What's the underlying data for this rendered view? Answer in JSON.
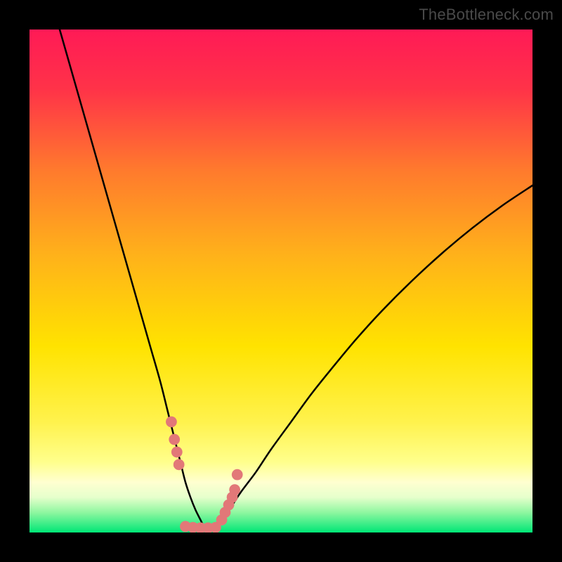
{
  "watermark": "TheBottleneck.com",
  "chart_data": {
    "type": "line",
    "title": "",
    "xlabel": "",
    "ylabel": "",
    "xlim": [
      0,
      100
    ],
    "ylim": [
      0,
      100
    ],
    "background_gradient": {
      "stops": [
        {
          "pct": 0,
          "color": "#ff1a56"
        },
        {
          "pct": 12,
          "color": "#ff3348"
        },
        {
          "pct": 28,
          "color": "#ff7a2d"
        },
        {
          "pct": 45,
          "color": "#ffb21a"
        },
        {
          "pct": 63,
          "color": "#ffe300"
        },
        {
          "pct": 78,
          "color": "#fff24d"
        },
        {
          "pct": 86,
          "color": "#ffff8c"
        },
        {
          "pct": 90,
          "color": "#ffffd0"
        },
        {
          "pct": 93,
          "color": "#e6ffcc"
        },
        {
          "pct": 96,
          "color": "#8ff7a0"
        },
        {
          "pct": 100,
          "color": "#00e676"
        }
      ]
    },
    "series": [
      {
        "name": "left-curve",
        "x": [
          6,
          8,
          10,
          12,
          14,
          16,
          18,
          20,
          22,
          24,
          26,
          27.5,
          29,
          30,
          31,
          32,
          33,
          34,
          34.5,
          35
        ],
        "y": [
          100,
          93,
          86,
          79,
          72,
          65,
          58,
          51,
          44,
          37,
          30,
          24,
          18,
          14,
          10,
          7,
          4.5,
          2.5,
          1.5,
          1
        ]
      },
      {
        "name": "right-curve",
        "x": [
          35,
          36,
          38,
          40,
          42,
          45,
          48,
          52,
          56,
          60,
          65,
          70,
          76,
          82,
          88,
          94,
          100
        ],
        "y": [
          1,
          1.2,
          2.5,
          5,
          8,
          12,
          16.5,
          22,
          27.5,
          32.5,
          38.5,
          44,
          50,
          55.5,
          60.5,
          65,
          69
        ]
      }
    ],
    "markers": {
      "name": "bottleneck-points",
      "color": "#e27878",
      "radius_plot_units": 1.1,
      "points": [
        {
          "x": 28.2,
          "y": 22.0
        },
        {
          "x": 28.8,
          "y": 18.5
        },
        {
          "x": 29.3,
          "y": 16.0
        },
        {
          "x": 29.7,
          "y": 13.5
        },
        {
          "x": 31.0,
          "y": 1.2
        },
        {
          "x": 32.5,
          "y": 1.0
        },
        {
          "x": 34.0,
          "y": 0.9
        },
        {
          "x": 35.5,
          "y": 0.9
        },
        {
          "x": 37.0,
          "y": 1.0
        },
        {
          "x": 38.2,
          "y": 2.5
        },
        {
          "x": 38.9,
          "y": 4.0
        },
        {
          "x": 39.6,
          "y": 5.5
        },
        {
          "x": 40.3,
          "y": 7.0
        },
        {
          "x": 40.8,
          "y": 8.5
        },
        {
          "x": 41.3,
          "y": 11.5
        }
      ]
    }
  }
}
